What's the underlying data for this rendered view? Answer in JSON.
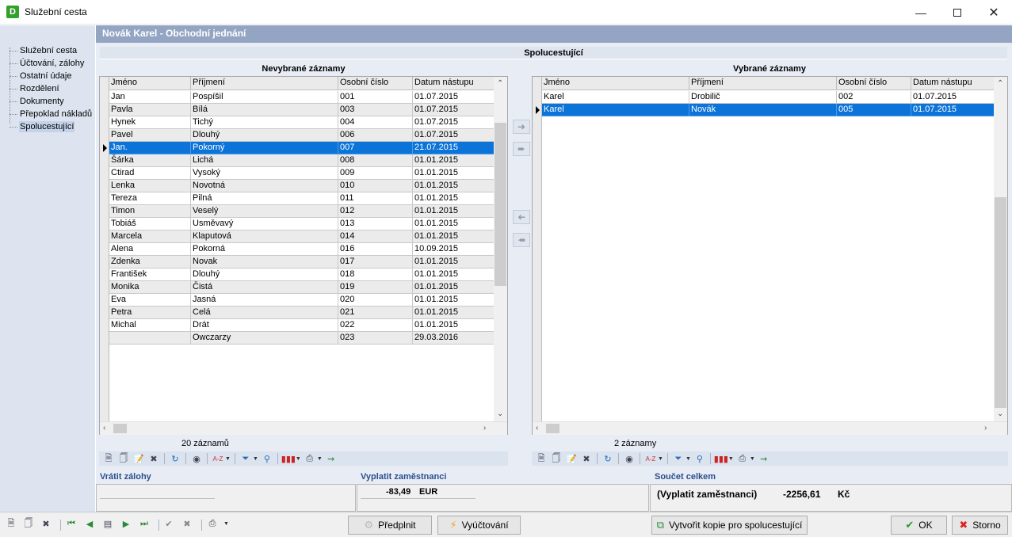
{
  "window": {
    "title": "Služební cesta",
    "logo_letter": "D"
  },
  "nav": {
    "items": [
      {
        "label": "Služební cesta"
      },
      {
        "label": "Účtování, zálohy"
      },
      {
        "label": "Ostatní údaje"
      },
      {
        "label": "Rozdělení"
      },
      {
        "label": "Dokumenty"
      },
      {
        "label": "Přepoklad nákladů"
      },
      {
        "label": "Spolucestující"
      }
    ],
    "selected_index": 6
  },
  "header": {
    "title": "Novák Karel  -  Obchodní jednání"
  },
  "section": {
    "title": "Spolucestující"
  },
  "columns": [
    "Jméno",
    "Příjmení",
    "Osobní číslo",
    "Datum nástupu"
  ],
  "left_grid": {
    "title": "Nevybrané záznamy",
    "count_label": "20 záznamů",
    "selected_row": 4,
    "rows": [
      [
        "Jan",
        "Pospíšil",
        "001",
        "01.07.2015"
      ],
      [
        "Pavla",
        "Bílá",
        "003",
        "01.07.2015"
      ],
      [
        "Hynek",
        "Tichý",
        "004",
        "01.07.2015"
      ],
      [
        "Pavel",
        "Dlouhý",
        "006",
        "01.07.2015"
      ],
      [
        "Jan.",
        "Pokorný",
        "007",
        "21.07.2015"
      ],
      [
        "Šárka",
        "Lichá",
        "008",
        "01.01.2015"
      ],
      [
        "Ctirad",
        "Vysoký",
        "009",
        "01.01.2015"
      ],
      [
        "Lenka",
        "Novotná",
        "010",
        "01.01.2015"
      ],
      [
        "Tereza",
        "Pilná",
        "011",
        "01.01.2015"
      ],
      [
        "Timon",
        "Veselý",
        "012",
        "01.01.2015"
      ],
      [
        "Tobiáš",
        "Usměvavý",
        "013",
        "01.01.2015"
      ],
      [
        "Marcela",
        "Klaputová",
        "014",
        "01.01.2015"
      ],
      [
        "Alena",
        "Pokorná",
        "016",
        "10.09.2015"
      ],
      [
        "Zdenka",
        "Novak",
        "017",
        "01.01.2015"
      ],
      [
        "František",
        "Dlouhý",
        "018",
        "01.01.2015"
      ],
      [
        "Monika",
        "Čistá",
        "019",
        "01.01.2015"
      ],
      [
        "Eva",
        "Jasná",
        "020",
        "01.01.2015"
      ],
      [
        "Petra",
        "Celá",
        "021",
        "01.01.2015"
      ],
      [
        "Michal",
        "Drát",
        "022",
        "01.01.2015"
      ],
      [
        "",
        "Owczarzy",
        "023",
        "29.03.2016"
      ]
    ]
  },
  "right_grid": {
    "title": "Vybrané záznamy",
    "count_label": "2 záznamy",
    "selected_row": 1,
    "rows": [
      [
        "Karel",
        "Drobilič",
        "002",
        "01.07.2015"
      ],
      [
        "Karel",
        "Novák",
        "005",
        "01.07.2015"
      ]
    ]
  },
  "summary": {
    "return_label": "Vrátit zálohy",
    "pay_label": "Vyplatit zaměstnanci",
    "pay_value": "-83,49",
    "pay_currency": "EUR",
    "total_label": "Součet celkem",
    "total_text": "(Vyplatit zaměstnanci)",
    "total_value": "-2256,61",
    "total_currency": "Kč"
  },
  "buttons": {
    "prefill": "Předplnit",
    "settlement": "Vyúčtování",
    "copy": "Vytvořit kopie pro spolucestující",
    "ok": "OK",
    "cancel": "Storno"
  },
  "colors": {
    "selection": "#0c74d8",
    "header_strip": "#94a5c3",
    "nav_bg": "#dde4f0",
    "summary_header_text": "#2a4f8c"
  }
}
